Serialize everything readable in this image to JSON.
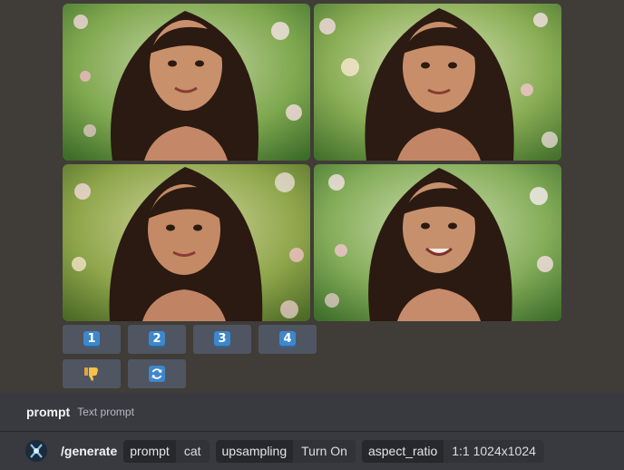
{
  "grid": {
    "images": [
      {
        "label": "girl-portrait-1"
      },
      {
        "label": "girl-portrait-2"
      },
      {
        "label": "girl-portrait-3"
      },
      {
        "label": "girl-portrait-4"
      }
    ]
  },
  "actions": {
    "select_buttons": [
      "1",
      "2",
      "3",
      "4"
    ],
    "dislike_icon": "thumbs-down-icon",
    "regenerate_icon": "refresh-icon"
  },
  "composer": {
    "active_option": {
      "name": "prompt",
      "description": "Text prompt"
    },
    "command": "/generate",
    "options": [
      {
        "key": "prompt",
        "value": "cat"
      },
      {
        "key": "upsampling",
        "value": "Turn On"
      },
      {
        "key": "aspect_ratio",
        "value": "1:1 1024x1024"
      }
    ]
  },
  "colors": {
    "background": "#403c37",
    "button": "#4f5661",
    "keycap": "#3e87cc",
    "composer": "#383a40",
    "chip_key": "#26282c",
    "chip_value": "#313338"
  }
}
